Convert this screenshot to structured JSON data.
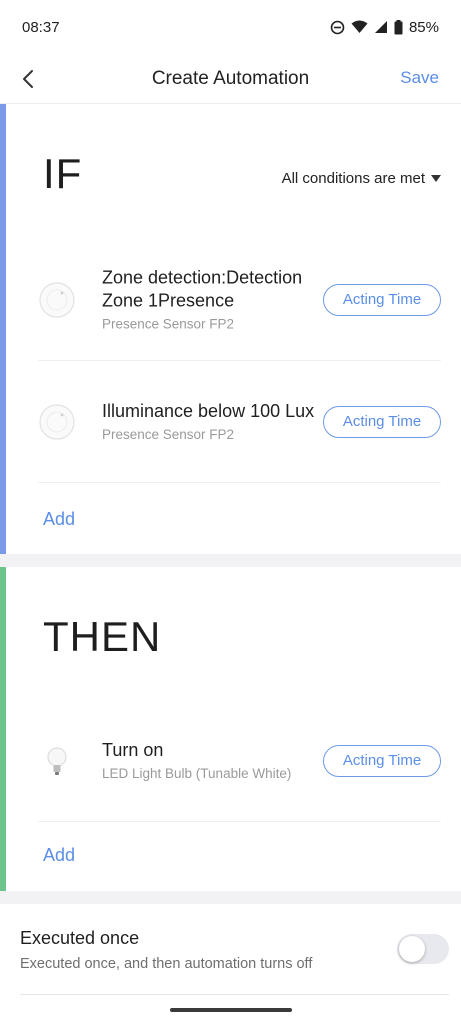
{
  "status_bar": {
    "time": "08:37",
    "battery": "85%",
    "icons": [
      "do-not-disturb-icon",
      "wifi-icon",
      "signal-icon",
      "battery-icon"
    ]
  },
  "header": {
    "title": "Create Automation",
    "save_label": "Save",
    "back_icon": "chevron-left-icon"
  },
  "if_section": {
    "title": "IF",
    "accent_color": "#7b9ae8",
    "condition_mode": "All conditions are met",
    "items": [
      {
        "title": "Zone detection:Detection Zone 1Presence",
        "subtitle": "Presence Sensor FP2",
        "icon": "presence-sensor-icon",
        "button_label": "Acting Time"
      },
      {
        "title": "Illuminance below 100 Lux",
        "subtitle": "Presence Sensor FP2",
        "icon": "presence-sensor-icon",
        "button_label": "Acting Time"
      }
    ],
    "add_label": "Add"
  },
  "then_section": {
    "title": "THEN",
    "accent_color": "#6cc48a",
    "items": [
      {
        "title": "Turn on",
        "subtitle": "LED Light Bulb (Tunable White)",
        "icon": "light-bulb-icon",
        "button_label": "Acting Time"
      }
    ],
    "add_label": "Add"
  },
  "executed_once": {
    "title": "Executed once",
    "description": "Executed once, and then automation turns off",
    "enabled": false
  },
  "colors": {
    "accent_blue": "#5b8ee6",
    "if_bar": "#7b9ae8",
    "then_bar": "#6cc48a"
  }
}
